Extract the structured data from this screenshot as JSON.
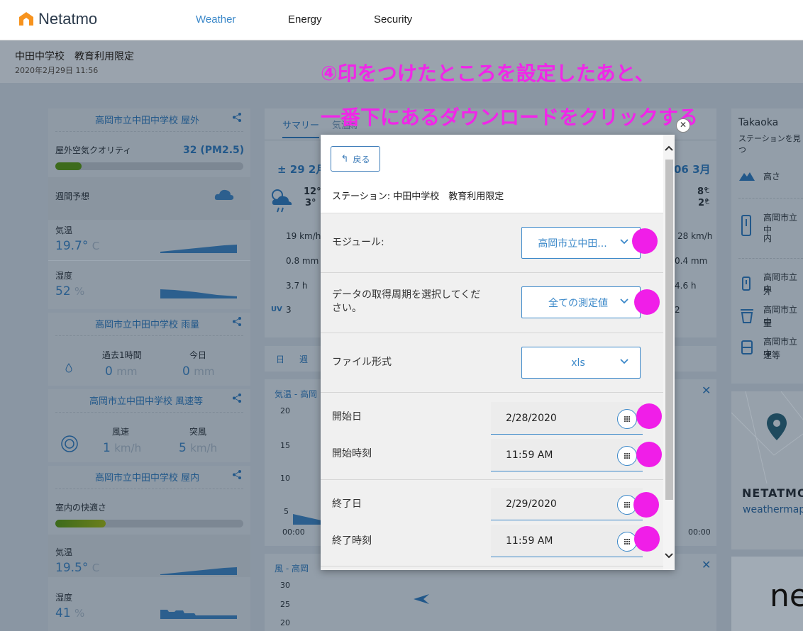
{
  "header": {
    "logo_text": "Netatmo",
    "nav": [
      "Weather",
      "Energy",
      "Security"
    ]
  },
  "station": {
    "title": "中田中学校　教育利用限定",
    "datetime": "2020年2月29日 11:56"
  },
  "annotation": {
    "line1": "④印をつけたところを設定したあと、",
    "line2": "一番下にあるダウンロードをクリックする"
  },
  "left_cards": {
    "outdoor": {
      "title": "高岡市立中田中学校  屋外",
      "air_quality_label": "屋外空気クオリティ",
      "air_quality_value": "32  (PM2.5)",
      "forecast_label": "週間予想",
      "temp_label": "気温",
      "temp_value": "19.7°",
      "temp_unit": "C",
      "humidity_label": "湿度",
      "humidity_value": "52",
      "humidity_unit": "%"
    },
    "rain": {
      "title": "高岡市立中田中学校  雨量",
      "col1_label": "過去1時間",
      "col2_label": "今日",
      "col1_value": "0",
      "col2_value": "0",
      "unit": "mm"
    },
    "wind": {
      "title": "高岡市立中田中学校  風速等",
      "col1_label": "風速",
      "col2_label": "突風",
      "col1_value": "1",
      "col2_value": "5",
      "unit": "km/h"
    },
    "indoor": {
      "title": "高岡市立中田中学校  屋内",
      "comfort_label": "室内の快適さ",
      "temp_label": "気温",
      "temp_value": "19.5°",
      "temp_unit": "C",
      "humidity_label": "湿度",
      "humidity_value": "41",
      "humidity_unit": "%"
    }
  },
  "center_bg": {
    "tab_summary": "サマリー",
    "tab_other": "気温",
    "tab_rain": "雨",
    "date_left": "± 29 2月",
    "date_right": "06 3月",
    "temp_left_hi": "12°",
    "temp_left_lo": "3°",
    "temp_right_hi": "8°",
    "temp_right_lo": "2°",
    "deg_c": "C",
    "wind_left": "19 km/h",
    "wind_right": "28 km/h",
    "rain_left": "0.8 mm",
    "rain_right": "0.4 mm",
    "sun_left": "3.7 h",
    "sun_right": "4.6 h",
    "uv_label": "UV",
    "uv_left": "3",
    "uv_right": "2",
    "range_day": "日",
    "range_week": "週",
    "chart1_label": "気温 -  高岡",
    "chart1_y": [
      "20",
      "15",
      "10",
      "5"
    ],
    "chart_x_left": "00:00",
    "chart_x_right": "00:00",
    "chart2_label": "風 -  高岡",
    "chart2_y": [
      "30",
      "25",
      "20"
    ]
  },
  "right_bg": {
    "city": "Takaoka",
    "sub": "ステーションを見つ",
    "altitude": "高さ",
    "item1": "高岡市立中",
    "item1b": "内",
    "item2": "高岡市立中",
    "item2b": "外",
    "item3": "高岡市立中",
    "item3b": "量",
    "item4": "高岡市立中",
    "item4b": "速等",
    "brand": "NETATMO",
    "brand_link": "weathermap",
    "partial": "ne"
  },
  "modal": {
    "back_label": "戻る",
    "station_label": "ステーション: 中田中学校　教育利用限定",
    "module_label": "モジュール:",
    "module_value": "高岡市立中田...",
    "period_label": "データの取得周期を選択してください。",
    "period_value": "全ての測定値",
    "format_label": "ファイル形式",
    "format_value": "xls",
    "start_date_label": "開始日",
    "start_date_value": "2/28/2020",
    "start_time_label": "開始時刻",
    "start_time_value": "11:59 AM",
    "end_date_label": "終了日",
    "end_date_value": "2/29/2020",
    "end_time_label": "終了時刻",
    "end_time_value": "11:59 AM"
  },
  "colors": {
    "accent": "#3b88c9",
    "marker": "#f01ee8",
    "annotation": "#f026e8"
  }
}
